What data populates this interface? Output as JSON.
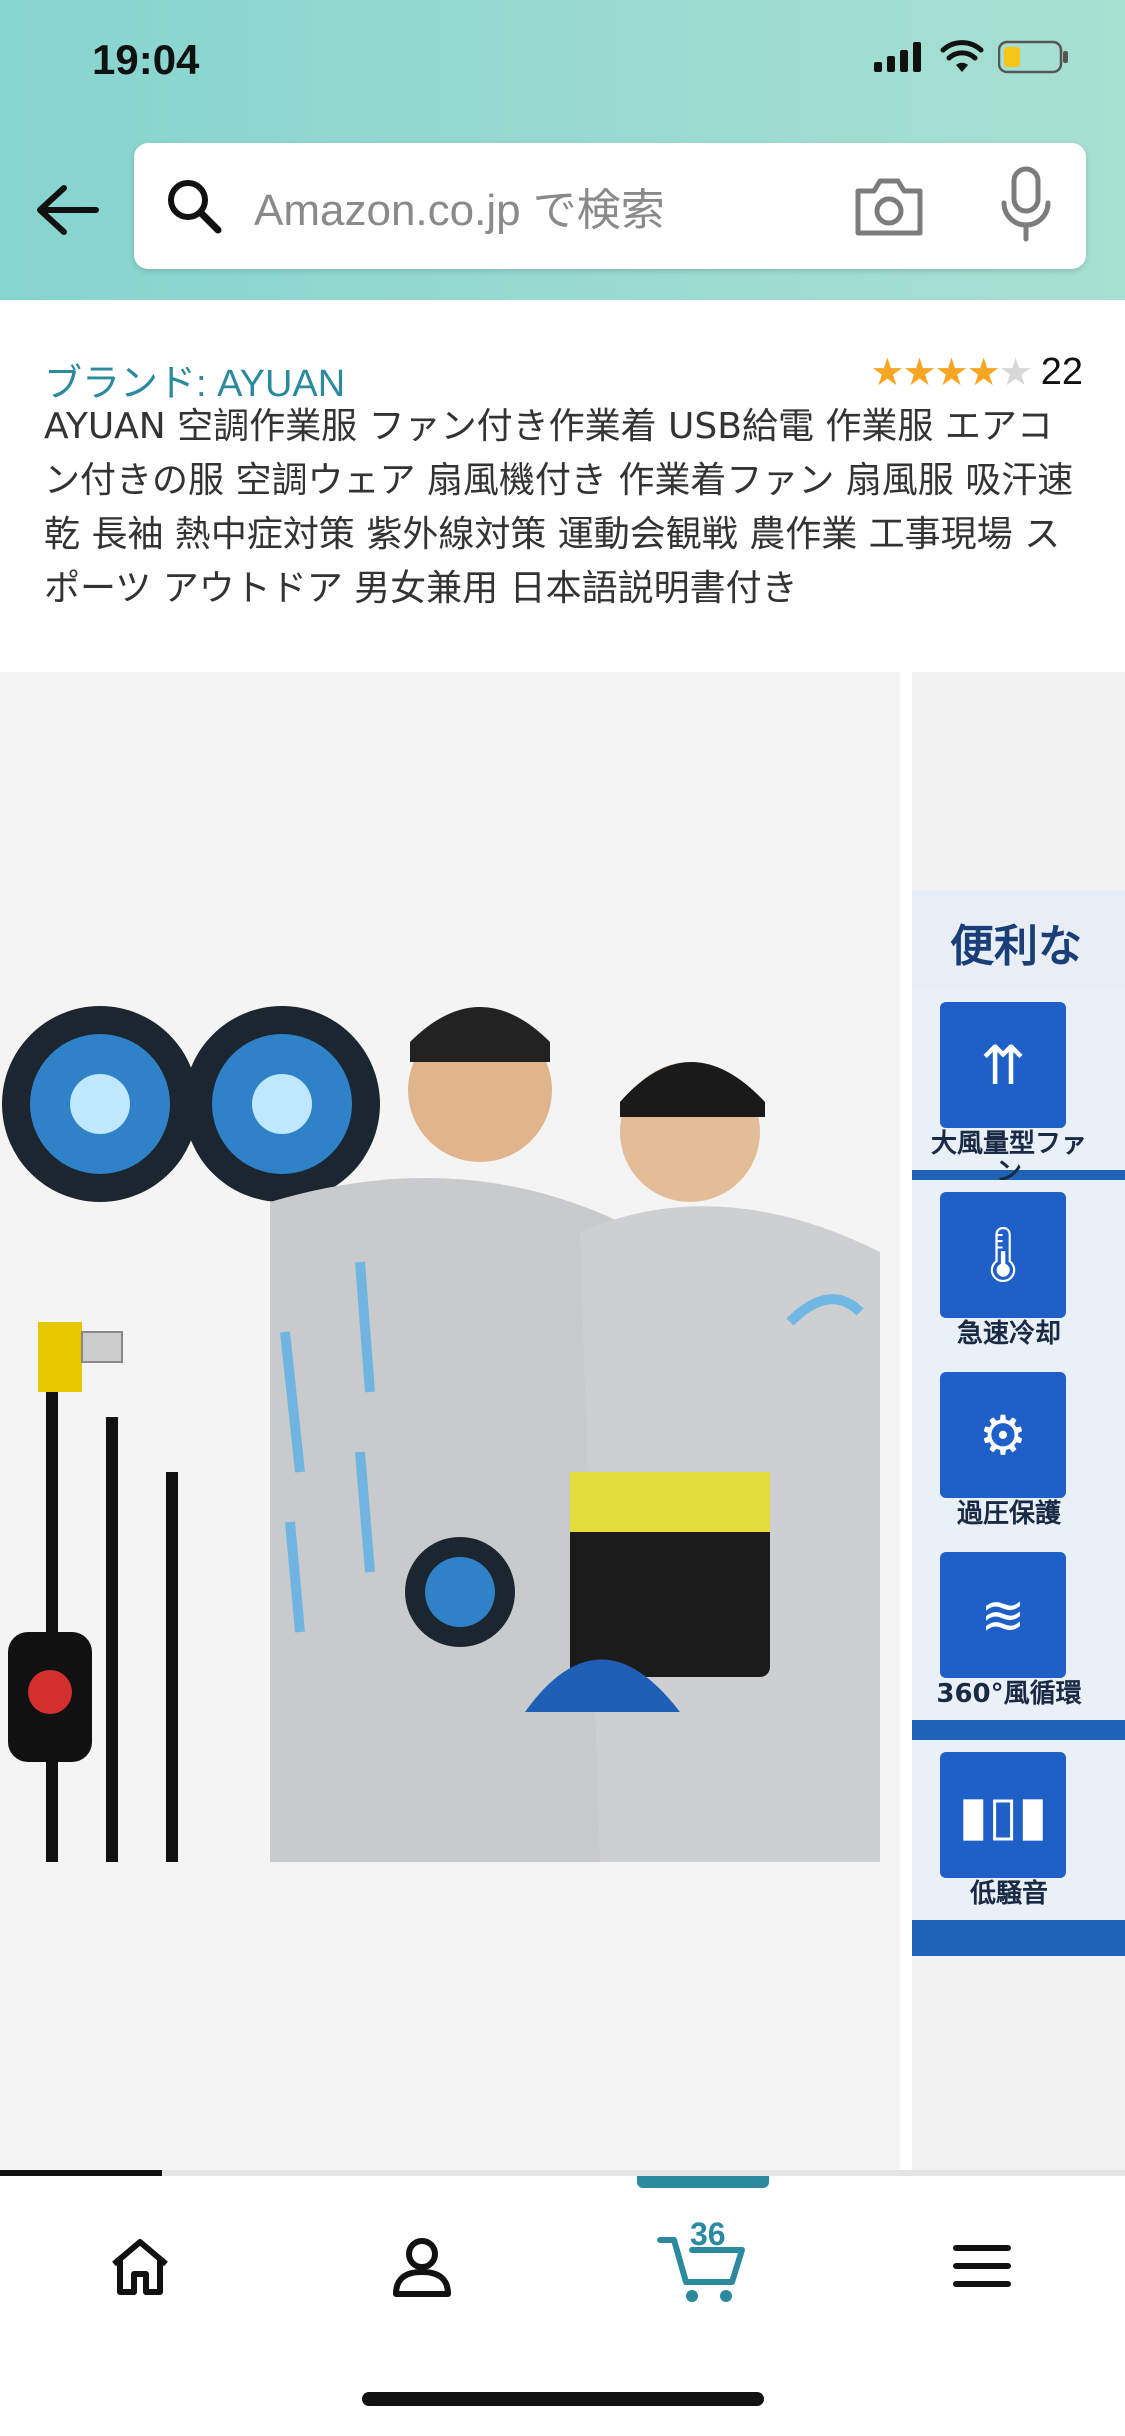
{
  "status_bar": {
    "time": "19:04"
  },
  "search": {
    "placeholder": "Amazon.co.jp で検索"
  },
  "product": {
    "brand": "ブランド: AYUAN",
    "rating_count": "22",
    "rating_value": 4,
    "title": "AYUAN 空調作業服 ファン付き作業着 USB給電 作業服 エアコン付きの服 空調ウェア 扇風機付き 作業着ファン 扇風服 吸汗速乾 長袖 熱中症対策 紫外線対策 運動会観戦 農作業 工事現場 スポーツ アウトドア 男女兼用 日本語説明書付き"
  },
  "gallery": {
    "side_image": {
      "heading": "便利な",
      "features": [
        {
          "label": "大風量型ファン",
          "icon": "airflow-icon"
        },
        {
          "label": "急速冷却",
          "icon": "thermometer-icon"
        },
        {
          "label": "過圧保護",
          "icon": "gear-icon"
        },
        {
          "label": "360°風循環",
          "icon": "wind-icon"
        },
        {
          "label": "低騒音",
          "icon": "soundwave-icon"
        }
      ]
    },
    "image_progress": 0.144
  },
  "tabbar": {
    "cart_count": "36",
    "tabs": [
      "home-icon",
      "account-icon",
      "cart-icon",
      "menu-icon"
    ]
  },
  "colors": {
    "header": "#a0dccf",
    "link": "#2b8a9e",
    "star": "#f6a623"
  }
}
